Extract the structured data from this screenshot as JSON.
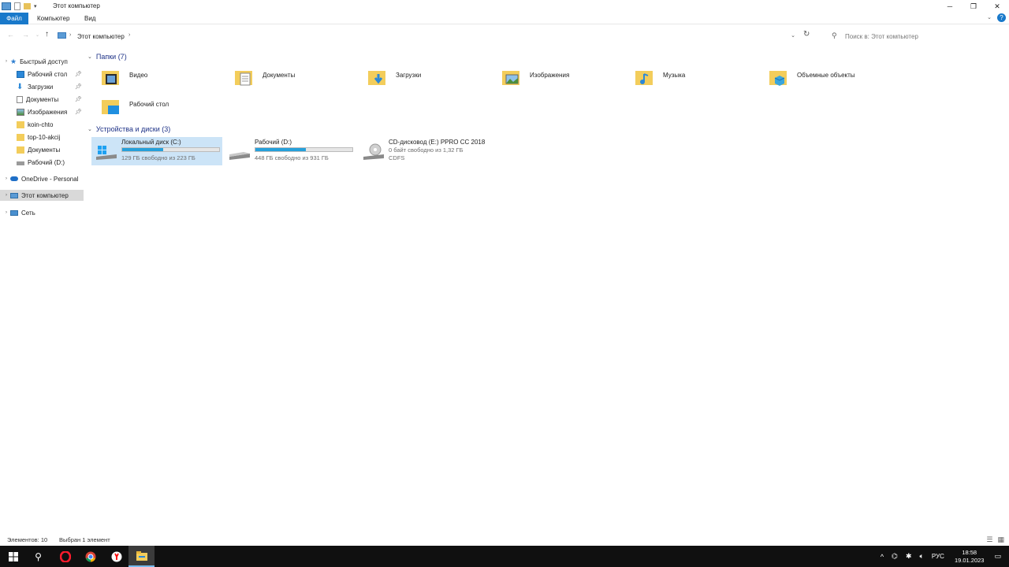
{
  "window": {
    "title": "Этот компьютер"
  },
  "ribbon": {
    "tabs": [
      "Файл",
      "Компьютер",
      "Вид"
    ]
  },
  "address": {
    "crumb": "Этот компьютер",
    "search_placeholder": "Поиск в: Этот компьютер"
  },
  "sidebar": {
    "quick_access": "Быстрый доступ",
    "items": [
      {
        "label": "Рабочий стол",
        "pinned": true
      },
      {
        "label": "Загрузки",
        "pinned": true
      },
      {
        "label": "Документы",
        "pinned": true
      },
      {
        "label": "Изображения",
        "pinned": true
      },
      {
        "label": "koin-chto",
        "pinned": false
      },
      {
        "label": "top-10-akcij",
        "pinned": false
      },
      {
        "label": "Документы",
        "pinned": false
      },
      {
        "label": "Рабочий (D:)",
        "pinned": false
      }
    ],
    "onedrive": "OneDrive - Personal",
    "this_pc": "Этот компьютер",
    "network": "Сеть"
  },
  "folders": {
    "header": "Папки (7)",
    "items": [
      "Видео",
      "Документы",
      "Загрузки",
      "Изображения",
      "Музыка",
      "Объемные объекты",
      "Рабочий стол"
    ]
  },
  "devices": {
    "header": "Устройства и диски (3)",
    "items": [
      {
        "name": "Локальный диск (C:)",
        "free": "129 ГБ свободно из 223 ГБ",
        "used_fraction": 0.42,
        "selected": true
      },
      {
        "name": "Рабочий (D:)",
        "free": "448 ГБ свободно из 931 ГБ",
        "used_fraction": 0.52,
        "selected": false
      },
      {
        "name": "CD-дисковод (E:) PPRO CC 2018",
        "free": "0 байт свободно из 1,32 ГБ",
        "fs": "CDFS",
        "selected": false
      }
    ]
  },
  "status": {
    "count": "Элементов: 10",
    "selected": "Выбран 1 элемент"
  },
  "taskbar": {
    "lang": "РУС",
    "time": "18:58",
    "date": "19.01.2023"
  },
  "colors": {
    "accent": "#1979ca",
    "bar_fill": "#26a0da",
    "selection": "#cce4f7"
  }
}
